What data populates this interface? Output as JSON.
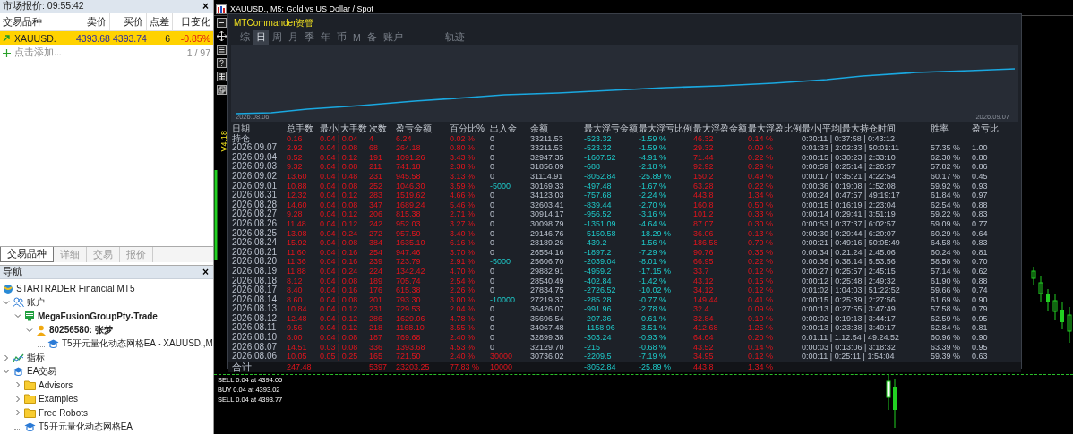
{
  "market_watch": {
    "title": "市场报价: 09:55:42",
    "close": "×",
    "columns": [
      "交易品种",
      "卖价",
      "买价",
      "点差",
      "日变化"
    ],
    "rows": [
      {
        "symbol": "XAUUSD.",
        "bid": "4393.68",
        "ask": "4393.74",
        "spread": "6",
        "change": "-0.85%",
        "selected": true
      }
    ],
    "add_label": "点击添加...",
    "count": "1 / 97",
    "tabs": [
      {
        "label": "交易品种",
        "selected": true
      },
      {
        "label": "详细",
        "selected": false
      },
      {
        "label": "交易",
        "selected": false
      },
      {
        "label": "报价",
        "selected": false
      }
    ]
  },
  "navigator": {
    "title": "导航",
    "close": "×",
    "items": [
      {
        "label": "STARTRADER Financial MT5",
        "kind": "broker",
        "bold": false
      },
      {
        "label": "账户",
        "kind": "accounts",
        "bold": false,
        "expanded": true,
        "children": [
          {
            "label": "MegaFusionGroupPty-Trade",
            "kind": "server",
            "bold": true,
            "expanded": true,
            "children": [
              {
                "label": "80256580: 张梦",
                "kind": "user",
                "bold": true,
                "expanded": true,
                "children": [
                  {
                    "label": "T5开元量化动态网格EA - XAUUSD.,M",
                    "kind": "ea",
                    "bold": false
                  }
                ]
              }
            ]
          }
        ]
      },
      {
        "label": "指标",
        "kind": "indicators",
        "bold": false,
        "expanded": false
      },
      {
        "label": "EA交易",
        "kind": "ea",
        "bold": false,
        "expanded": true,
        "children": [
          {
            "label": "Advisors",
            "kind": "folder",
            "bold": false,
            "expanded": false
          },
          {
            "label": "Examples",
            "kind": "folder",
            "bold": false,
            "expanded": false
          },
          {
            "label": "Free Robots",
            "kind": "folder",
            "bold": false,
            "expanded": false
          },
          {
            "label": "T5开元量化动态网格EA",
            "kind": "ea",
            "bold": false
          }
        ]
      }
    ]
  },
  "chart_window": {
    "title": "XAUUSD., M5:  Gold vs US Dollar / Spot",
    "version": "V4.18",
    "orders": [
      {
        "label": "SELL 0.04 at 4394.05"
      },
      {
        "label": "BUY 0.04 at 4393.02"
      },
      {
        "label": "SELL 0.04 at 4393.77"
      }
    ]
  },
  "commander": {
    "title": "MTCommander资管",
    "tabs": [
      {
        "label": "综",
        "selected": false
      },
      {
        "label": "日",
        "selected": true
      },
      {
        "label": "周",
        "selected": false
      },
      {
        "label": "月",
        "selected": false
      },
      {
        "label": "季",
        "selected": false
      },
      {
        "label": "年",
        "selected": false
      },
      {
        "label": "币",
        "selected": false
      },
      {
        "label": "M",
        "selected": false
      },
      {
        "label": "备",
        "selected": false
      },
      {
        "label": "账户",
        "selected": false
      },
      {
        "label": "轨迹",
        "selected": false
      }
    ],
    "equity_start": "2026.08.06",
    "equity_end": "2026.09.07",
    "columns": [
      {
        "label": "日期",
        "kind": "date"
      },
      {
        "label": "总手数",
        "kind": "profit"
      },
      {
        "label": "最小|大手数",
        "kind": "profit"
      },
      {
        "label": "次数",
        "kind": "profit"
      },
      {
        "label": "盈亏金额",
        "kind": "profit"
      },
      {
        "label": "百分比%",
        "kind": "profit"
      },
      {
        "label": "出入金",
        "kind": "flow"
      },
      {
        "label": "余额",
        "kind": "plain"
      },
      {
        "label": "最大浮亏金额",
        "kind": "drawdown"
      },
      {
        "label": "最大浮亏比例",
        "kind": "drawdown"
      },
      {
        "label": "最大浮盈金额",
        "kind": "profit"
      },
      {
        "label": "最大浮盈比例",
        "kind": "profit"
      },
      {
        "label": "最小|平均|最大持仓时间",
        "kind": "plain"
      },
      {
        "label": "胜率",
        "kind": "plain"
      },
      {
        "label": "盈亏比",
        "kind": "plain"
      }
    ],
    "rows": [
      {
        "cells": [
          "持仓",
          "0.16",
          "0.04 | 0.04",
          "4",
          "6.24",
          "0.02 %",
          "0",
          "33211.53",
          "-523.32",
          "-1.59 %",
          "46.32",
          "0.14 %",
          "0:30:11 | 0:37:58 | 0:43:12",
          "",
          ""
        ],
        "kind": "none"
      },
      {
        "cells": [
          "2026.09.07",
          "2.92",
          "0.04 | 0.08",
          "68",
          "264.18",
          "0.80 %",
          "0",
          "33211.53",
          "-523.32",
          "-1.59 %",
          "29.32",
          "0.09 %",
          "0:01:33 | 2:02:33 | 50:01:11",
          "57.35 %",
          "1.00"
        ],
        "kind": "none"
      },
      {
        "cells": [
          "2026.09.04",
          "8.52",
          "0.04 | 0.12",
          "191",
          "1091.26",
          "3.43 %",
          "0",
          "32947.35",
          "-1607.52",
          "-4.91 %",
          "71.44",
          "0.22 %",
          "0:00:15 | 0:30:23 | 2:33:10",
          "62.30 %",
          "0.80"
        ],
        "kind": "none"
      },
      {
        "cells": [
          "2026.09.03",
          "9.32",
          "0.04 | 0.08",
          "211",
          "741.18",
          "2.38 %",
          "0",
          "31856.09",
          "-688",
          "-2.18 %",
          "92.92",
          "0.29 %",
          "0:00:59 | 0:25:14 | 2:26:57",
          "57.82 %",
          "0.86"
        ],
        "kind": "none"
      },
      {
        "cells": [
          "2026.09.02",
          "13.60",
          "0.04 | 0.48",
          "231",
          "945.58",
          "3.13 %",
          "0",
          "31114.91",
          "-8052.84",
          "-25.89 %",
          "150.2",
          "0.49 %",
          "0:00:17 | 0:35:21 | 4:22:54",
          "60.17 %",
          "0.45"
        ],
        "kind": "none"
      },
      {
        "cells": [
          "2026.09.01",
          "10.88",
          "0.04 | 0.08",
          "252",
          "1046.30",
          "3.59 %",
          "-5000",
          "30169.33",
          "-497.48",
          "-1.67 %",
          "63.28",
          "0.22 %",
          "0:00:36 | 0:19:08 | 1:52:08",
          "59.92 %",
          "0.93"
        ],
        "kind": "withdrawal"
      },
      {
        "cells": [
          "2026.08.31",
          "12.32",
          "0.04 | 0.12",
          "283",
          "1519.62",
          "4.66 %",
          "0",
          "34123.03",
          "-757.68",
          "-2.24 %",
          "443.8",
          "1.34 %",
          "0:00:24 | 0:47:57 | 49:19:17",
          "61.84 %",
          "0.97"
        ],
        "kind": "none"
      },
      {
        "cells": [
          "2026.08.28",
          "14.60",
          "0.04 | 0.08",
          "347",
          "1689.24",
          "5.46 %",
          "0",
          "32603.41",
          "-839.44",
          "-2.70 %",
          "160.8",
          "0.50 %",
          "0:00:15 | 0:16:19 | 2:23:04",
          "62.54 %",
          "0.88"
        ],
        "kind": "none"
      },
      {
        "cells": [
          "2026.08.27",
          "9.28",
          "0.04 | 0.12",
          "206",
          "815.38",
          "2.71 %",
          "0",
          "30914.17",
          "-956.52",
          "-3.16 %",
          "101.2",
          "0.33 %",
          "0:00:14 | 0:29:41 | 3:51:19",
          "59.22 %",
          "0.83"
        ],
        "kind": "none"
      },
      {
        "cells": [
          "2026.08.26",
          "11.48",
          "0.04 | 0.12",
          "242",
          "952.03",
          "3.27 %",
          "0",
          "30098.79",
          "-1351.09",
          "-4.64 %",
          "87.07",
          "0.30 %",
          "0:00:53 | 0:37:37 | 6:02:57",
          "59.09 %",
          "0.77"
        ],
        "kind": "none"
      },
      {
        "cells": [
          "2026.08.25",
          "13.08",
          "0.04 | 0.24",
          "272",
          "957.50",
          "3.40 %",
          "0",
          "29146.76",
          "-5150.58",
          "-18.29 %",
          "36.06",
          "0.13 %",
          "0:00:30 | 0:29:44 | 6:20:07",
          "60.29 %",
          "0.64"
        ],
        "kind": "none"
      },
      {
        "cells": [
          "2026.08.24",
          "15.92",
          "0.04 | 0.08",
          "384",
          "1635.10",
          "6.16 %",
          "0",
          "28189.26",
          "-439.2",
          "-1.56 %",
          "186.58",
          "0.70 %",
          "0:00:21 | 0:49:16 | 50:05:49",
          "64.58 %",
          "0.83"
        ],
        "kind": "none"
      },
      {
        "cells": [
          "2026.08.21",
          "11.60",
          "0.04 | 0.16",
          "254",
          "947.46",
          "3.70 %",
          "0",
          "26554.16",
          "-1897.2",
          "-7.29 %",
          "90.76",
          "0.35 %",
          "0:00:34 | 0:21:24 | 2:45:06",
          "60.24 %",
          "0.81"
        ],
        "kind": "none"
      },
      {
        "cells": [
          "2026.08.20",
          "11.36",
          "0.04 | 0.16",
          "239",
          "723.79",
          "2.91 %",
          "-5000",
          "25606.70",
          "-2039.04",
          "-8.01 %",
          "66.95",
          "0.22 %",
          "0:00:36 | 0:38:14 | 5:53:56",
          "58.58 %",
          "0.70"
        ],
        "kind": "withdrawal"
      },
      {
        "cells": [
          "2026.08.19",
          "11.88",
          "0.04 | 0.24",
          "224",
          "1342.42",
          "4.70 %",
          "0",
          "29882.91",
          "-4959.2",
          "-17.15 %",
          "33.7",
          "0.12 %",
          "0:00:27 | 0:25:57 | 2:45:15",
          "57.14 %",
          "0.62"
        ],
        "kind": "none"
      },
      {
        "cells": [
          "2026.08.18",
          "8.12",
          "0.04 | 0.08",
          "189",
          "705.74",
          "2.54 %",
          "0",
          "28540.49",
          "-402.84",
          "-1.42 %",
          "43.12",
          "0.15 %",
          "0:00:12 | 0:25:48 | 2:49:32",
          "61.90 %",
          "0.88"
        ],
        "kind": "none"
      },
      {
        "cells": [
          "2026.08.17",
          "8.40",
          "0.04 | 0.16",
          "176",
          "615.38",
          "2.26 %",
          "0",
          "27834.75",
          "-2726.52",
          "-10.02 %",
          "34.12",
          "0.12 %",
          "0:01:02 | 1:04:03 | 51:22:52",
          "59.66 %",
          "0.74"
        ],
        "kind": "none"
      },
      {
        "cells": [
          "2026.08.14",
          "8.60",
          "0.04 | 0.08",
          "201",
          "793.30",
          "3.00 %",
          "-10000",
          "27219.37",
          "-285.28",
          "-0.77 %",
          "149.44",
          "0.41 %",
          "0:00:15 | 0:25:39 | 2:27:56",
          "61.69 %",
          "0.90"
        ],
        "kind": "withdrawal"
      },
      {
        "cells": [
          "2026.08.13",
          "10.84",
          "0.04 | 0.12",
          "231",
          "729.53",
          "2.04 %",
          "0",
          "36426.07",
          "-991.96",
          "-2.78 %",
          "32.4",
          "0.09 %",
          "0:00:13 | 0:27:55 | 3:47:49",
          "57.58 %",
          "0.79"
        ],
        "kind": "none"
      },
      {
        "cells": [
          "2026.08.12",
          "12.48",
          "0.04 | 0.12",
          "286",
          "1629.06",
          "4.78 %",
          "0",
          "35696.54",
          "-207.36",
          "-0.61 %",
          "32.84",
          "0.10 %",
          "0:00:02 | 0:19:13 | 3:44:17",
          "62.59 %",
          "0.95"
        ],
        "kind": "none"
      },
      {
        "cells": [
          "2026.08.11",
          "9.56",
          "0.04 | 0.12",
          "218",
          "1168.10",
          "3.55 %",
          "0",
          "34067.48",
          "-1158.96",
          "-3.51 %",
          "412.68",
          "1.25 %",
          "0:00:13 | 0:23:38 | 3:49:17",
          "62.84 %",
          "0.81"
        ],
        "kind": "none"
      },
      {
        "cells": [
          "2026.08.10",
          "8.00",
          "0.04 | 0.08",
          "187",
          "769.68",
          "2.40 %",
          "0",
          "32899.38",
          "-303.24",
          "-0.93 %",
          "64.64",
          "0.20 %",
          "0:01:11 | 1:12:54 | 49:24:52",
          "60.96 %",
          "0.90"
        ],
        "kind": "none"
      },
      {
        "cells": [
          "2026.08.07",
          "14.51",
          "0.03 | 0.08",
          "336",
          "1393.68",
          "4.53 %",
          "0",
          "32129.70",
          "-215",
          "-0.68 %",
          "43.52",
          "0.14 %",
          "0:00:03 | 0:13:06 | 3:18:32",
          "63.39 %",
          "0.95"
        ],
        "kind": "none"
      },
      {
        "cells": [
          "2026.08.06",
          "10.05",
          "0.05 | 0.25",
          "165",
          "721.50",
          "2.40 %",
          "30000",
          "30736.02",
          "-2209.5",
          "-7.19 %",
          "34.95",
          "0.12 %",
          "0:00:11 | 0:25:11 | 1:54:04",
          "59.39 %",
          "0.63"
        ],
        "kind": "deposit"
      }
    ],
    "total": {
      "cells": [
        "合计",
        "247.48",
        "",
        "5397",
        "23203.25",
        "77.83 %",
        "10000",
        "",
        "-8052.84",
        "-25.89 %",
        "443.8",
        "1.34 %",
        "",
        "",
        ""
      ],
      "kind": "deposit"
    }
  }
}
